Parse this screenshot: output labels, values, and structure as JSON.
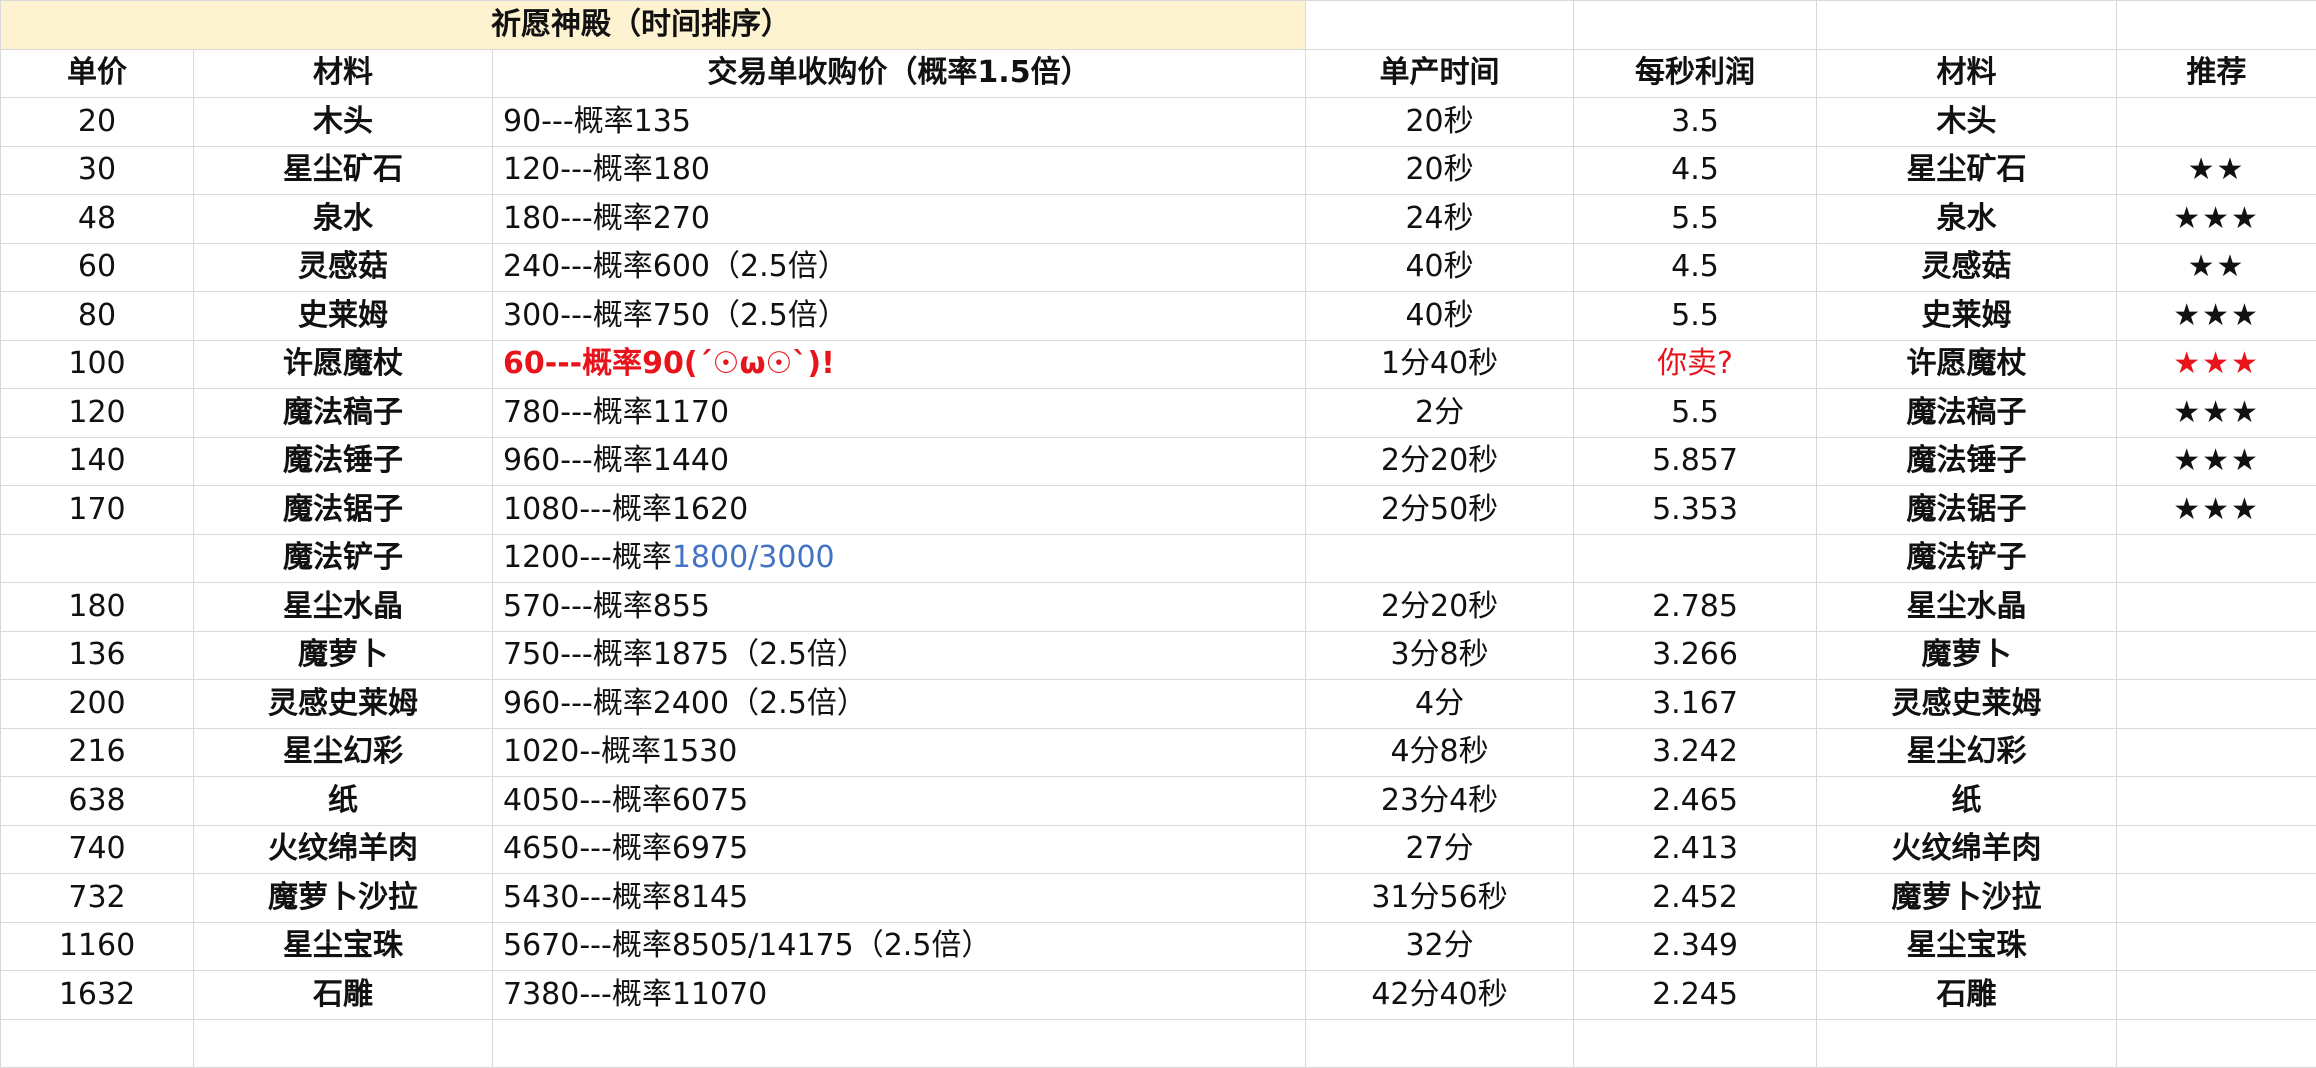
{
  "title": "祈愿神殿（时间排序）",
  "headers": {
    "price": "单价",
    "material": "材料",
    "trade": "交易单收购价（概率1.5倍）",
    "time": "单产时间",
    "profit": "每秒利润",
    "material2": "材料",
    "recommend": "推荐"
  },
  "rows": [
    {
      "price": "20",
      "material": "木头",
      "trade_main": "90---概率135",
      "trade_extra": "",
      "time": "20秒",
      "profit": "3.5",
      "material2": "木头",
      "stars": ""
    },
    {
      "price": "30",
      "material": "星尘矿石",
      "trade_main": "120---概率180",
      "trade_extra": "",
      "time": "20秒",
      "profit": "4.5",
      "material2": "星尘矿石",
      "stars": "★★"
    },
    {
      "price": "48",
      "material": "泉水",
      "trade_main": "180---概率270",
      "trade_extra": "",
      "time": "24秒",
      "profit": "5.5",
      "material2": "泉水",
      "stars": "★★★"
    },
    {
      "price": "60",
      "material": "灵感菇",
      "trade_main": "240---概率600（2.5倍）",
      "trade_extra": "",
      "time": "40秒",
      "profit": "4.5",
      "material2": "灵感菇",
      "stars": "★★"
    },
    {
      "price": "80",
      "material": "史莱姆",
      "trade_main": "300---概率750（2.5倍）",
      "trade_extra": "",
      "time": "40秒",
      "profit": "5.5",
      "material2": "史莱姆",
      "stars": "★★★"
    },
    {
      "price": "100",
      "material": "许愿魔杖",
      "trade_main": "60---概率90(´☉ω☉`)!",
      "trade_extra": "",
      "time": "1分40秒",
      "profit": "你卖?",
      "material2": "许愿魔杖",
      "stars": "★★★"
    },
    {
      "price": "120",
      "material": "魔法稿子",
      "trade_main": "780---概率1170",
      "trade_extra": "",
      "time": "2分",
      "profit": "5.5",
      "material2": "魔法稿子",
      "stars": "★★★"
    },
    {
      "price": "140",
      "material": "魔法锤子",
      "trade_main": "960---概率1440",
      "trade_extra": "",
      "time": "2分20秒",
      "profit": "5.857",
      "material2": "魔法锤子",
      "stars": "★★★"
    },
    {
      "price": "170",
      "material": "魔法锯子",
      "trade_main": "1080---概率1620",
      "trade_extra": "",
      "time": "2分50秒",
      "profit": "5.353",
      "material2": "魔法锯子",
      "stars": "★★★"
    },
    {
      "price": "",
      "material": "魔法铲子",
      "trade_main": "1200---概率",
      "trade_extra": "1800/3000",
      "time": "",
      "profit": "",
      "material2": "魔法铲子",
      "stars": ""
    },
    {
      "price": "180",
      "material": "星尘水晶",
      "trade_main": "570---概率855",
      "trade_extra": "",
      "time": "2分20秒",
      "profit": "2.785",
      "material2": "星尘水晶",
      "stars": ""
    },
    {
      "price": "136",
      "material": "魔萝卜",
      "trade_main": "750---概率1875（2.5倍）",
      "trade_extra": "",
      "time": "3分8秒",
      "profit": "3.266",
      "material2": "魔萝卜",
      "stars": ""
    },
    {
      "price": "200",
      "material": "灵感史莱姆",
      "trade_main": "960---概率2400（2.5倍）",
      "trade_extra": "",
      "time": "4分",
      "profit": "3.167",
      "material2": "灵感史莱姆",
      "stars": ""
    },
    {
      "price": "216",
      "material": "星尘幻彩",
      "trade_main": "1020--概率1530",
      "trade_extra": "",
      "time": "4分8秒",
      "profit": "3.242",
      "material2": "星尘幻彩",
      "stars": ""
    },
    {
      "price": "638",
      "material": "纸",
      "trade_main": "4050---概率6075",
      "trade_extra": "",
      "time": "23分4秒",
      "profit": "2.465",
      "material2": "纸",
      "stars": ""
    },
    {
      "price": "740",
      "material": "火纹绵羊肉",
      "trade_main": "4650---概率6975",
      "trade_extra": "",
      "time": "27分",
      "profit": "2.413",
      "material2": "火纹绵羊肉",
      "stars": ""
    },
    {
      "price": "732",
      "material": "魔萝卜沙拉",
      "trade_main": "5430---概率8145",
      "trade_extra": "",
      "time": "31分56秒",
      "profit": "2.452",
      "material2": "魔萝卜沙拉",
      "stars": ""
    },
    {
      "price": "1160",
      "material": "星尘宝珠",
      "trade_main": "5670---概率8505/14175（2.5倍）",
      "trade_extra": "",
      "time": "32分",
      "profit": "2.349",
      "material2": "星尘宝珠",
      "stars": ""
    },
    {
      "price": "1632",
      "material": "石雕",
      "trade_main": "7380---概率11070",
      "trade_extra": "",
      "time": "42分40秒",
      "profit": "2.245",
      "material2": "石雕",
      "stars": ""
    }
  ],
  "colors": {
    "title_bg": "#fdf3d0",
    "grid": "#d9d9d9",
    "highlight_red": "#e8141b",
    "link_blue": "#4472c4"
  }
}
